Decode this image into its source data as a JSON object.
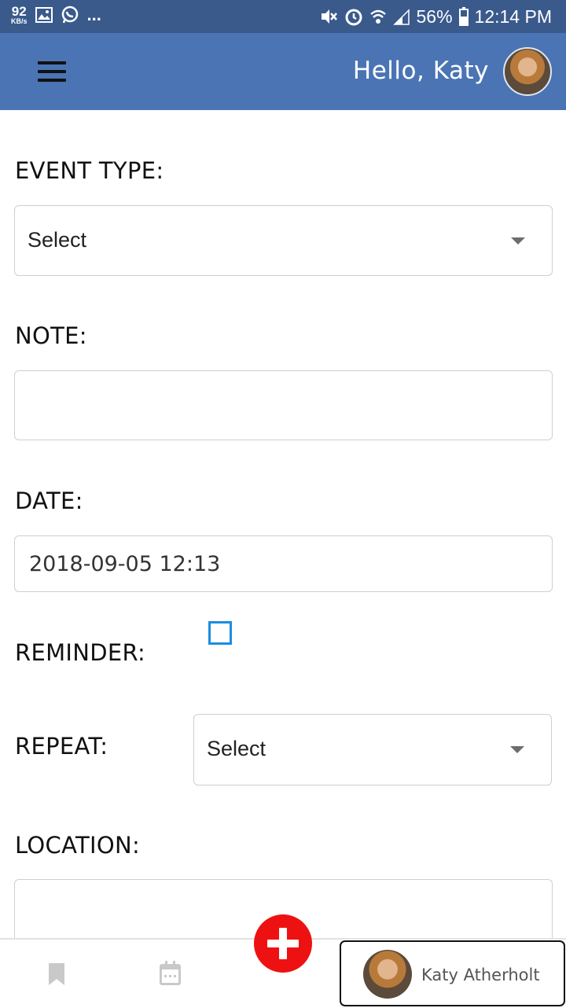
{
  "status_bar": {
    "speed_value": "92",
    "speed_unit": "KB/s",
    "overflow": "...",
    "battery": "56%",
    "time": "12:14 PM"
  },
  "header": {
    "greeting": "Hello, Katy"
  },
  "form": {
    "event_type_label": "EVENT TYPE:",
    "event_type_value": "Select",
    "note_label": "NOTE:",
    "note_value": "",
    "date_label": "DATE:",
    "date_value": "2018-09-05 12:13",
    "reminder_label": "REMINDER:",
    "repeat_label": "REPEAT:",
    "repeat_value": "Select",
    "location_label": "LOCATION:",
    "location_value": ""
  },
  "bottom_nav": {
    "profile_name": "Katy Atherholt"
  },
  "colors": {
    "status_bar": "#3a5a8c",
    "app_bar": "#4a74b4",
    "fab": "#ee1111",
    "checkbox": "#1a8ee0"
  }
}
